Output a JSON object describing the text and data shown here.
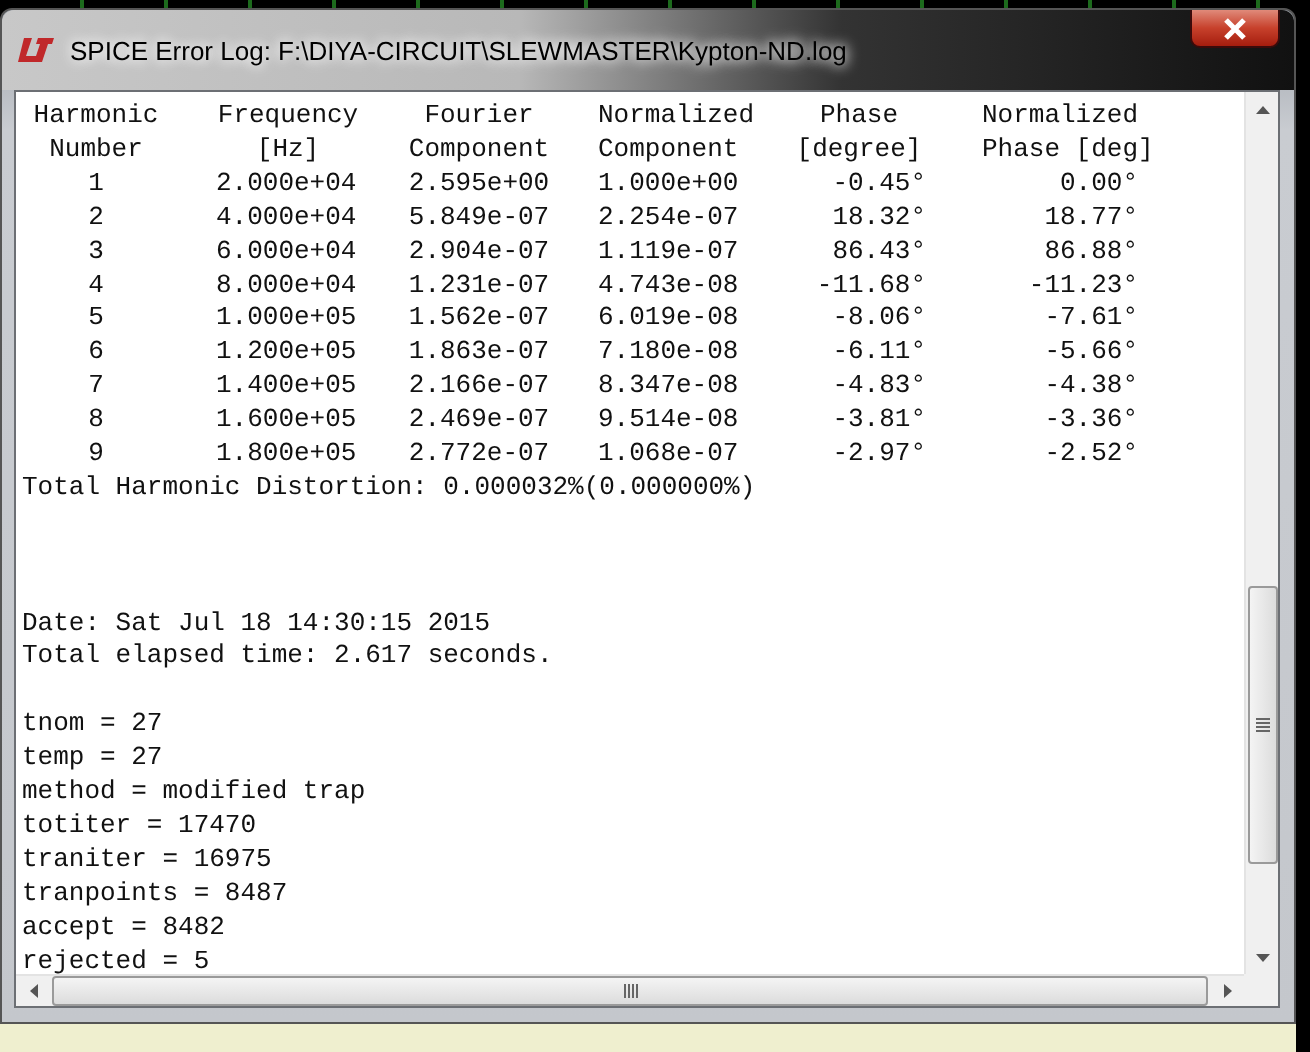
{
  "window": {
    "title": "SPICE Error Log: F:\\DIYA-CIRCUIT\\SLEWMASTER\\Kypton-ND.log"
  },
  "harmonics_table": {
    "header_rows": [
      [
        "Harmonic",
        "Frequency",
        "Fourier",
        "Normalized",
        "Phase",
        "Normalized"
      ],
      [
        "Number",
        "[Hz]",
        "Component",
        "Component",
        "[degree]",
        "Phase [deg]"
      ]
    ],
    "rows": [
      [
        "1",
        "2.000e+04",
        "2.595e+00",
        "1.000e+00",
        "-0.45°",
        "0.00°"
      ],
      [
        "2",
        "4.000e+04",
        "5.849e-07",
        "2.254e-07",
        "18.32°",
        "18.77°"
      ],
      [
        "3",
        "6.000e+04",
        "2.904e-07",
        "1.119e-07",
        "86.43°",
        "86.88°"
      ],
      [
        "4",
        "8.000e+04",
        "1.231e-07",
        "4.743e-08",
        "-11.68°",
        "-11.23°"
      ],
      [
        "5",
        "1.000e+05",
        "1.562e-07",
        "6.019e-08",
        "-8.06°",
        "-7.61°"
      ],
      [
        "6",
        "1.200e+05",
        "1.863e-07",
        "7.180e-08",
        "-6.11°",
        "-5.66°"
      ],
      [
        "7",
        "1.400e+05",
        "2.166e-07",
        "8.347e-08",
        "-4.83°",
        "-4.38°"
      ],
      [
        "8",
        "1.600e+05",
        "2.469e-07",
        "9.514e-08",
        "-3.81°",
        "-3.36°"
      ],
      [
        "9",
        "1.800e+05",
        "2.772e-07",
        "1.068e-07",
        "-2.97°",
        "-2.52°"
      ]
    ]
  },
  "thd_line": "Total Harmonic Distortion: 0.000032%(0.000000%)",
  "run_info": [
    "Date: Sat Jul 18 14:30:15 2015",
    "Total elapsed time: 2.617 seconds."
  ],
  "statistics": [
    "tnom = 27",
    "temp = 27",
    "method = modified trap",
    "totiter = 17470",
    "traniter = 16975",
    "tranpoints = 8487",
    "accept = 8482",
    "rejected = 5"
  ]
}
